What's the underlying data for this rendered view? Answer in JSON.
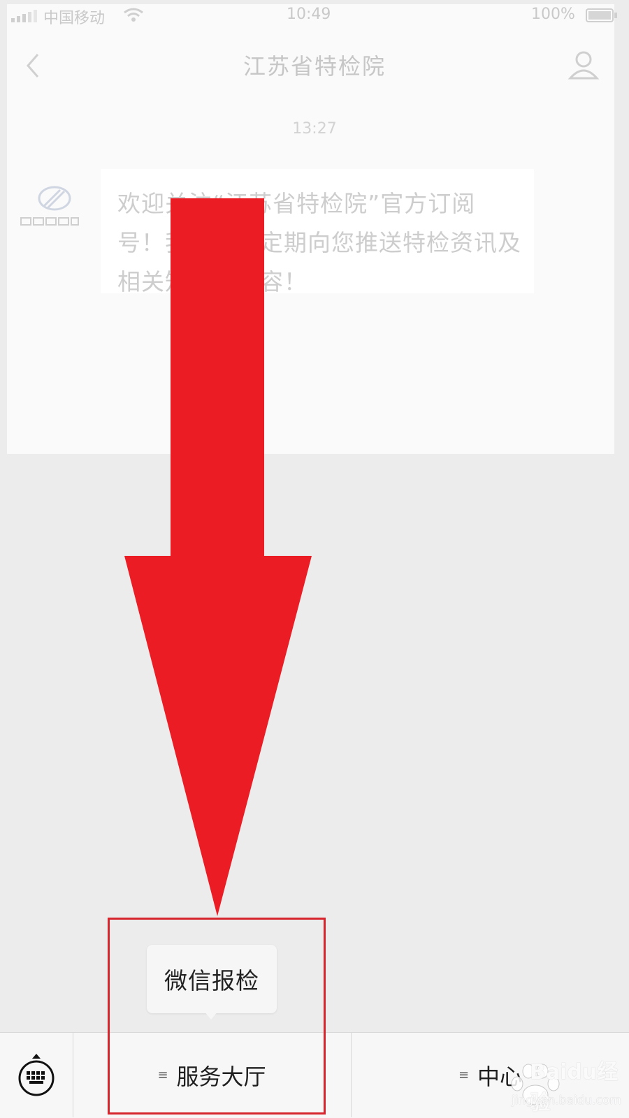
{
  "status_bar": {
    "carrier": "中国移动",
    "time": "10:49",
    "battery": "100%"
  },
  "nav": {
    "title": "江苏省特检院"
  },
  "chat": {
    "timestamp": "13:27",
    "message": "欢迎关注“江苏省特检院”官方订阅号！我们会不定期向您推送特检资讯及相关知识等内容！"
  },
  "popup": {
    "label": "微信报检"
  },
  "menu_bar": {
    "items": [
      {
        "label": "服务大厅"
      },
      {
        "label": "中心"
      }
    ]
  },
  "watermark": {
    "brand": "Baidu经验",
    "url": "jingyan.baidu.com"
  },
  "colors": {
    "arrow": "#ec1c24",
    "highlight": "#d7252d"
  }
}
